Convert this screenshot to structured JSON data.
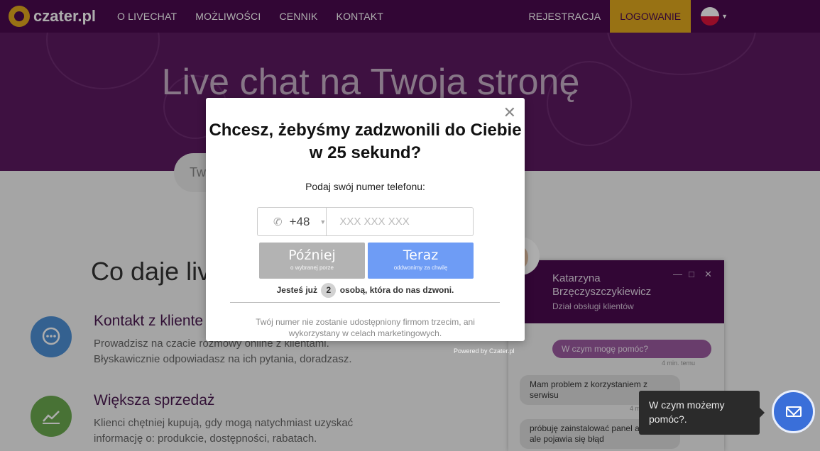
{
  "brand": {
    "logo_text": "czater.pl"
  },
  "nav": {
    "items": [
      "O LIVECHAT",
      "MOŻLIWOŚCI",
      "CENNIK",
      "KONTAKT"
    ],
    "register": "REJESTRACJA",
    "login": "LOGOWANIE",
    "language": "pl-flag"
  },
  "hero": {
    "title": "Live chat na Twoja stronę",
    "search_partial": "Tw"
  },
  "content": {
    "section_title": "Co daje liv",
    "features": [
      {
        "title": "Kontakt z kliente",
        "desc": "Prowadzisz na czacie rozmowy online z klientami. Błyskawicznie odpowiadasz na ich pytania, doradzasz.",
        "icon": "chat-bubble-icon",
        "color": "#4d8fd4"
      },
      {
        "title": "Większa sprzedaż",
        "desc": "Klienci chętniej kupują, gdy mogą natychmiast uzyskać informację o: produkcie, dostępności, rabatach.",
        "icon": "trend-chart-icon",
        "color": "#6aa84f"
      }
    ]
  },
  "modal": {
    "title": "Chcesz, żebyśmy zadzwonili do Ciebie w 25 sekund?",
    "subtitle": "Podaj swój numer telefonu:",
    "prefix": "+48",
    "phone_placeholder": "XXX XXX XXX",
    "later_label": "Później",
    "later_sub": "o wybranej porze",
    "now_label": "Teraz",
    "now_sub": "oddwonimy za chwilę",
    "count_before": "Jesteś już",
    "count_value": "2",
    "count_after": "osobą, która do nas dzwoni.",
    "disclaimer": "Twój numer nie zostanie udostępniony firmom trzecim, ani wykorzystany w celach marketingowych.",
    "powered_by": "Powered by Czater.pl"
  },
  "chat": {
    "agent_name": "Katarzyna Brzęczyszczykiewicz",
    "department": "Dział obsługi klientów",
    "messages": [
      {
        "from": "bot",
        "text": "W czym mogę pomóc?",
        "time": "4 min. temu"
      },
      {
        "from": "user",
        "text": "Mam problem z korzystaniem z serwisu",
        "time": "4 m"
      },
      {
        "from": "user",
        "text": "próbuję zainstalować panel aukcji, ale pojawia się błąd"
      }
    ],
    "tooltip": "W czym możemy pomóc?.",
    "accent": "#4a0a4e",
    "launcher_color": "#3a6fd9"
  }
}
